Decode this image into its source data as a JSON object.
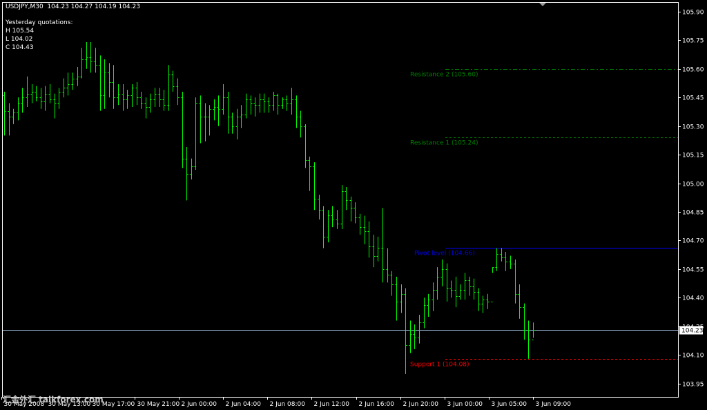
{
  "header": {
    "title": "USDJPY,M30  104.23 104.27 104.19 104.23",
    "yesterday_label": "Yesterday quotations:",
    "high": "H 105.54",
    "low": "L 104.02",
    "close": "C 104.43"
  },
  "watermark": "汇金外汇 talkforex.com",
  "colors": {
    "background": "#000000",
    "bars": "#00ff00",
    "axis": "#ffffff",
    "resistance": "#008000",
    "pivot": "#0000ff",
    "support": "#ff0000",
    "price_line": "#8fa9c9"
  },
  "chart_data": {
    "type": "ohlc-bar",
    "symbol": "USDJPY",
    "timeframe": "M30",
    "ylim": [
      103.88,
      105.95
    ],
    "y_ticks": [
      103.95,
      104.1,
      104.25,
      104.4,
      104.55,
      104.7,
      104.85,
      105.0,
      105.15,
      105.3,
      105.45,
      105.6,
      105.75,
      105.9
    ],
    "current_price": 104.23,
    "current_price_label": "104.23",
    "x_tick_labels": [
      "30 May 2008",
      "30 May 13:00",
      "30 May 17:00",
      "30 May 21:00",
      "2 Jun 00:00",
      "2 Jun 04:00",
      "2 Jun 08:00",
      "2 Jun 12:00",
      "2 Jun 16:00",
      "2 Jun 20:00",
      "3 Jun 00:00",
      "3 Jun 05:00",
      "3 Jun 09:00"
    ],
    "levels": [
      {
        "name": "Resistance 2",
        "label": "Resistance 2 (105.60)",
        "value": 105.6,
        "color": "#008000",
        "style": "dashdot"
      },
      {
        "name": "Resistance 1",
        "label": "Resistance 1 (105.24)",
        "value": 105.24,
        "color": "#008000",
        "style": "dashed"
      },
      {
        "name": "Pivot level",
        "label": "Pivot level (104.66)",
        "value": 104.66,
        "color": "#0000ff",
        "style": "solid"
      },
      {
        "name": "Support 1",
        "label": "Support 1 (104.08)",
        "value": 104.08,
        "color": "#ff0000",
        "style": "dashed"
      }
    ],
    "bars": [
      [
        105.46,
        105.48,
        105.25,
        105.38
      ],
      [
        105.38,
        105.42,
        105.25,
        105.35
      ],
      [
        105.35,
        105.39,
        105.31,
        105.37
      ],
      [
        105.37,
        105.45,
        105.33,
        105.42
      ],
      [
        105.42,
        105.5,
        105.37,
        105.45
      ],
      [
        105.45,
        105.56,
        105.4,
        105.47
      ],
      [
        105.47,
        105.52,
        105.42,
        105.48
      ],
      [
        105.48,
        105.51,
        105.43,
        105.45
      ],
      [
        105.45,
        105.5,
        105.39,
        105.43
      ],
      [
        105.43,
        105.51,
        105.38,
        105.47
      ],
      [
        105.47,
        105.52,
        105.42,
        105.44
      ],
      [
        105.44,
        105.47,
        105.34,
        105.42
      ],
      [
        105.42,
        105.5,
        105.39,
        105.48
      ],
      [
        105.48,
        105.55,
        105.45,
        105.5
      ],
      [
        105.5,
        105.58,
        105.46,
        105.52
      ],
      [
        105.52,
        105.58,
        105.49,
        105.55
      ],
      [
        105.55,
        105.61,
        105.51,
        105.56
      ],
      [
        105.56,
        105.71,
        105.55,
        105.65
      ],
      [
        105.65,
        105.74,
        105.6,
        105.66
      ],
      [
        105.66,
        105.74,
        105.58,
        105.64
      ],
      [
        105.64,
        105.71,
        105.58,
        105.62
      ],
      [
        105.62,
        105.67,
        105.38,
        105.46
      ],
      [
        105.46,
        105.65,
        105.39,
        105.58
      ],
      [
        105.58,
        105.63,
        105.45,
        105.53
      ],
      [
        105.53,
        105.62,
        105.39,
        105.45
      ],
      [
        105.45,
        105.52,
        105.41,
        105.47
      ],
      [
        105.47,
        105.52,
        105.38,
        105.44
      ],
      [
        105.44,
        105.49,
        105.39,
        105.46
      ],
      [
        105.46,
        105.52,
        105.4,
        105.5
      ],
      [
        105.5,
        105.53,
        105.41,
        105.45
      ],
      [
        105.45,
        105.48,
        105.39,
        105.42
      ],
      [
        105.42,
        105.45,
        105.34,
        105.4
      ],
      [
        105.4,
        105.47,
        105.37,
        105.44
      ],
      [
        105.44,
        105.5,
        105.4,
        105.47
      ],
      [
        105.47,
        105.5,
        105.4,
        105.44
      ],
      [
        105.44,
        105.49,
        105.38,
        105.41
      ],
      [
        105.41,
        105.62,
        105.38,
        105.57
      ],
      [
        105.57,
        105.59,
        105.48,
        105.51
      ],
      [
        105.51,
        105.55,
        105.41,
        105.45
      ],
      [
        105.45,
        105.48,
        105.08,
        105.13
      ],
      [
        105.13,
        105.19,
        104.91,
        105.05
      ],
      [
        105.05,
        105.13,
        105.02,
        105.09
      ],
      [
        105.09,
        105.45,
        105.07,
        105.42
      ],
      [
        105.42,
        105.46,
        105.21,
        105.35
      ],
      [
        105.35,
        105.42,
        105.22,
        105.35
      ],
      [
        105.35,
        105.41,
        105.25,
        105.39
      ],
      [
        105.39,
        105.44,
        105.33,
        105.4
      ],
      [
        105.4,
        105.46,
        105.3,
        105.39
      ],
      [
        105.39,
        105.52,
        105.36,
        105.45
      ],
      [
        105.45,
        105.48,
        105.26,
        105.35
      ],
      [
        105.35,
        105.37,
        105.26,
        105.3
      ],
      [
        105.3,
        105.39,
        105.23,
        105.35
      ],
      [
        105.35,
        105.41,
        105.29,
        105.36
      ],
      [
        105.36,
        105.47,
        105.34,
        105.44
      ],
      [
        105.44,
        105.46,
        105.36,
        105.42
      ],
      [
        105.42,
        105.45,
        105.35,
        105.41
      ],
      [
        105.41,
        105.47,
        105.37,
        105.44
      ],
      [
        105.44,
        105.47,
        105.37,
        105.43
      ],
      [
        105.43,
        105.45,
        105.37,
        105.41
      ],
      [
        105.41,
        105.48,
        105.38,
        105.46
      ],
      [
        105.46,
        105.47,
        105.36,
        105.41
      ],
      [
        105.41,
        105.45,
        105.39,
        105.44
      ],
      [
        105.44,
        105.46,
        105.38,
        105.42
      ],
      [
        105.42,
        105.5,
        105.36,
        105.44
      ],
      [
        105.44,
        105.46,
        105.29,
        105.35
      ],
      [
        105.35,
        105.38,
        105.24,
        105.3
      ],
      [
        105.3,
        105.31,
        105.08,
        105.12
      ],
      [
        105.12,
        105.14,
        104.96,
        105.09
      ],
      [
        105.09,
        105.11,
        104.86,
        104.92
      ],
      [
        104.92,
        104.94,
        104.81,
        104.86
      ],
      [
        104.86,
        104.88,
        104.66,
        104.72
      ],
      [
        104.72,
        104.86,
        104.69,
        104.83
      ],
      [
        104.83,
        104.88,
        104.77,
        104.81
      ],
      [
        104.81,
        104.86,
        104.76,
        104.79
      ],
      [
        104.79,
        104.99,
        104.76,
        104.96
      ],
      [
        104.96,
        104.98,
        104.86,
        104.91
      ],
      [
        104.91,
        104.93,
        104.8,
        104.87
      ],
      [
        104.87,
        104.9,
        104.79,
        104.82
      ],
      [
        104.82,
        104.84,
        104.73,
        104.77
      ],
      [
        104.77,
        104.83,
        104.68,
        104.75
      ],
      [
        104.75,
        104.8,
        104.61,
        104.67
      ],
      [
        104.67,
        104.73,
        104.56,
        104.62
      ],
      [
        104.62,
        104.72,
        104.59,
        104.66
      ],
      [
        104.66,
        104.87,
        104.48,
        104.55
      ],
      [
        104.55,
        104.66,
        104.48,
        104.52
      ],
      [
        104.52,
        104.54,
        104.41,
        104.47
      ],
      [
        104.47,
        104.51,
        104.28,
        104.38
      ],
      [
        104.38,
        104.47,
        104.32,
        104.42
      ],
      [
        104.42,
        104.45,
        104.0,
        104.15
      ],
      [
        104.15,
        104.28,
        104.11,
        104.21
      ],
      [
        104.21,
        104.26,
        104.13,
        104.19
      ],
      [
        104.19,
        104.31,
        104.16,
        104.27
      ],
      [
        104.27,
        104.4,
        104.24,
        104.36
      ],
      [
        104.36,
        104.42,
        104.3,
        104.39
      ],
      [
        104.39,
        104.48,
        104.33,
        104.44
      ],
      [
        104.44,
        104.56,
        104.39,
        104.51
      ],
      [
        104.51,
        104.6,
        104.46,
        104.55
      ],
      [
        104.55,
        104.58,
        104.38,
        104.45
      ],
      [
        104.45,
        104.49,
        104.4,
        104.44
      ],
      [
        104.44,
        104.51,
        104.35,
        104.41
      ],
      [
        104.41,
        104.47,
        104.39,
        104.44
      ],
      [
        104.44,
        104.53,
        104.39,
        104.49
      ],
      [
        104.49,
        104.51,
        104.41,
        104.46
      ],
      [
        104.46,
        104.5,
        104.39,
        104.43
      ],
      [
        104.43,
        104.45,
        104.33,
        104.37
      ],
      [
        104.37,
        104.41,
        104.32,
        104.39
      ],
      [
        104.39,
        104.42,
        104.34,
        104.38
      ],
      [
        104.38,
        104.56,
        104.53,
        104.56
      ],
      [
        104.56,
        104.66,
        104.54,
        104.63
      ],
      [
        104.63,
        104.66,
        104.59,
        104.61
      ],
      [
        104.61,
        104.64,
        104.54,
        104.59
      ],
      [
        104.59,
        104.62,
        104.55,
        104.58
      ],
      [
        104.58,
        104.6,
        104.37,
        104.42
      ],
      [
        104.42,
        104.47,
        104.29,
        104.35
      ],
      [
        104.35,
        104.37,
        104.18,
        104.23
      ],
      [
        104.23,
        104.28,
        104.08,
        104.18
      ],
      [
        104.18,
        104.27,
        104.19,
        104.23
      ]
    ]
  }
}
